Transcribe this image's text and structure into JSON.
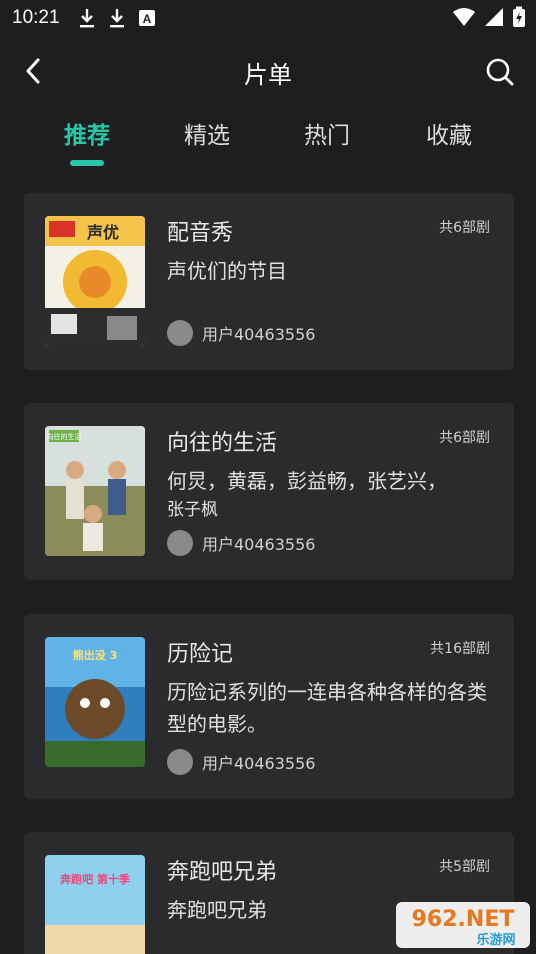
{
  "status_bar": {
    "time": "10:21",
    "left_icons": [
      "download-icon",
      "download-icon",
      "keyboard-a-icon"
    ],
    "right_icons": [
      "wifi-icon",
      "signal-icon",
      "battery-charging-icon"
    ],
    "a_glyph": "A"
  },
  "header": {
    "title": "片单",
    "back_icon": "chevron-left-icon",
    "search_icon": "search-icon"
  },
  "tabs": [
    {
      "label": "推荐",
      "active": true
    },
    {
      "label": "精选",
      "active": false
    },
    {
      "label": "热门",
      "active": false
    },
    {
      "label": "收藏",
      "active": false
    }
  ],
  "colors": {
    "accent": "#27c7a7",
    "background": "#1e1e20",
    "card": "#2b2b2e"
  },
  "playlists": [
    {
      "title": "配音秀",
      "count": "共6部剧",
      "desc": "声优们的节目",
      "desc_tail": "",
      "user": "用户40463556",
      "poster_text": "声优"
    },
    {
      "title": "向往的生活",
      "count": "共6部剧",
      "desc": "何炅，黄磊，彭益畅，张艺兴，",
      "desc_tail": "张子枫",
      "user": "用户40463556",
      "poster_text": "向往的生活"
    },
    {
      "title": "历险记",
      "count": "共16部剧",
      "desc": "历险记系列的一连串各种各样的各类型的电影。",
      "desc_tail": "",
      "user": "用户40463556",
      "poster_text": "熊出没 3"
    },
    {
      "title": "奔跑吧兄弟",
      "count": "共5部剧",
      "desc": "奔跑吧兄弟",
      "desc_tail": "",
      "user": "",
      "poster_text": "奔跑吧 第十季"
    }
  ],
  "watermark": {
    "brand": "962.NET",
    "sub": "乐游网"
  }
}
